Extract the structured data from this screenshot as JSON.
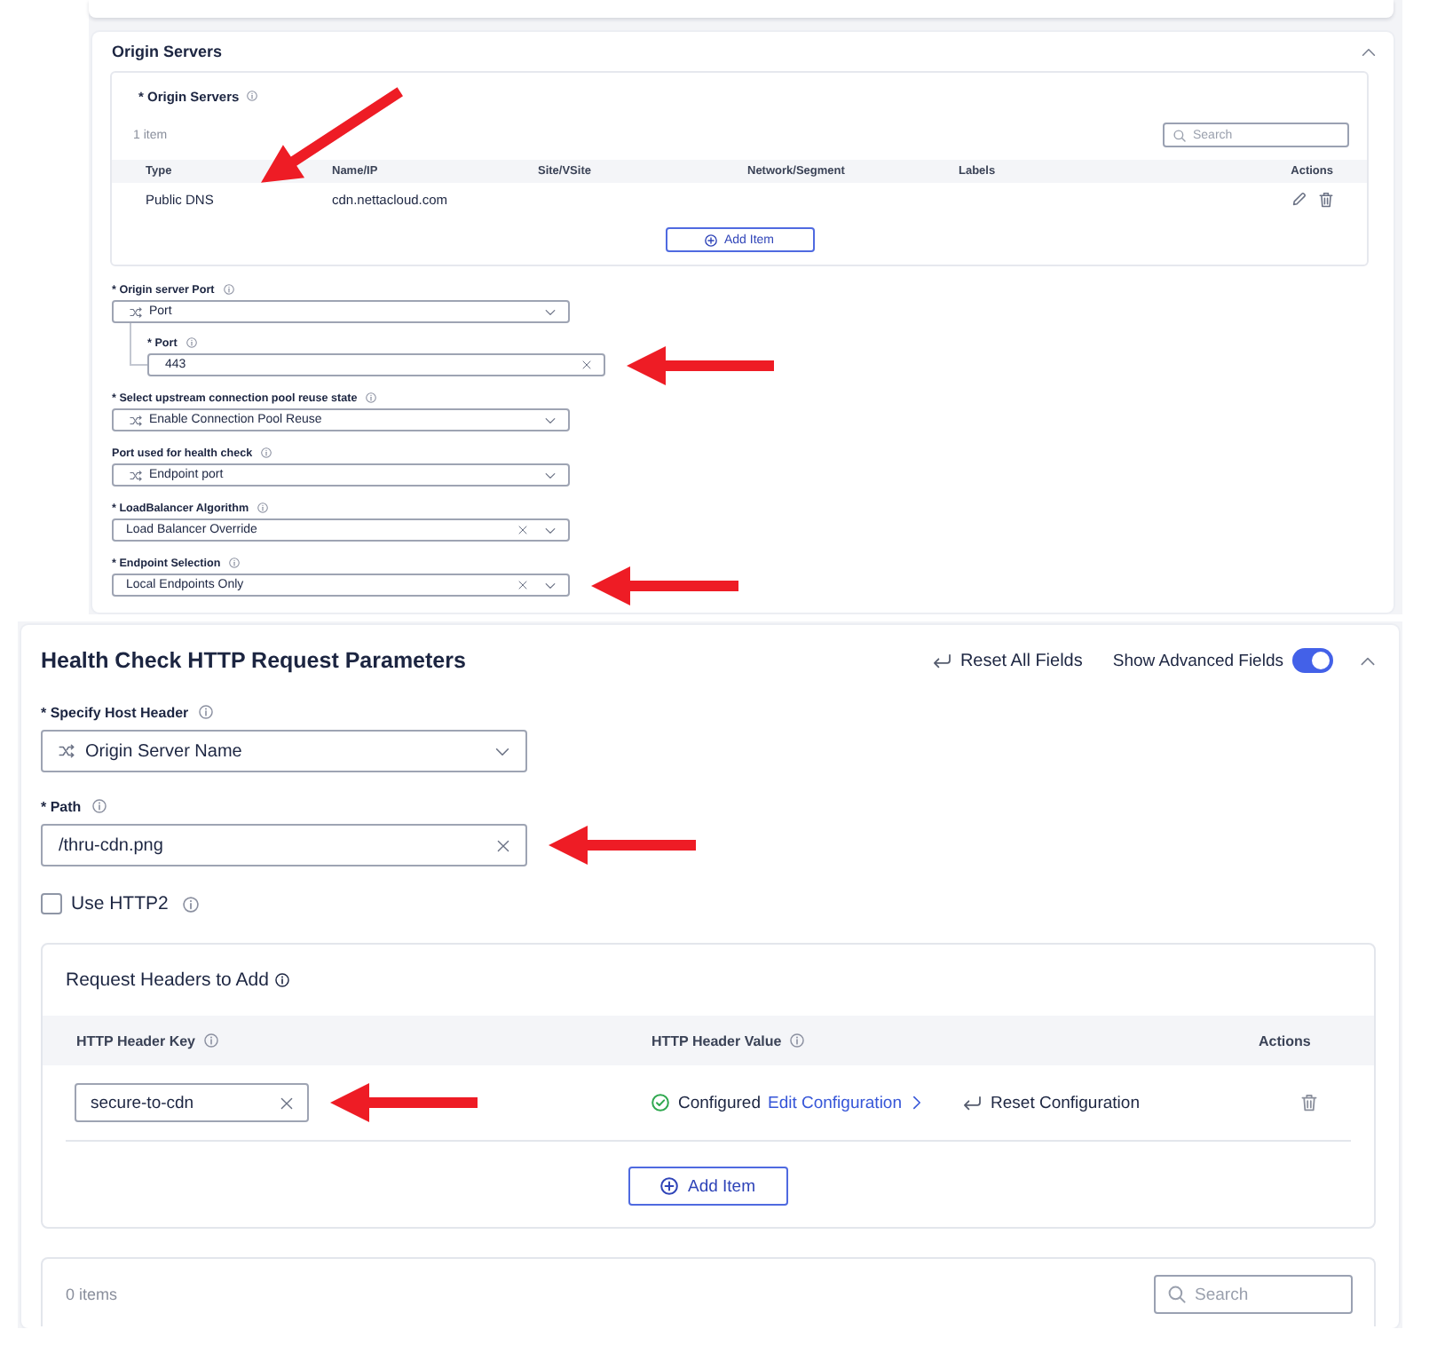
{
  "origin_servers": {
    "title": "Origin Servers",
    "expanded": true,
    "list": {
      "label": "* Origin Servers",
      "count": "1 item",
      "search": {
        "placeholder": "Search"
      },
      "columns": [
        "Type",
        "Name/IP",
        "Site/VSite",
        "Network/Segment",
        "Labels",
        "Actions"
      ],
      "rows": [
        {
          "type": "Public DNS",
          "name": "cdn.nettacloud.com",
          "arrow": true
        }
      ],
      "add_button": "Add Item"
    },
    "fields": [
      {
        "label": "* Origin server Port",
        "kind": "choice-select",
        "value": "Port",
        "arrow": false,
        "children": [
          {
            "label": "* Port",
            "kind": "text-input",
            "value": "443",
            "arrow": true
          }
        ]
      },
      {
        "label": "* Select upstream connection pool reuse state",
        "kind": "choice-select",
        "value": "Enable Connection Pool Reuse",
        "arrow": false
      },
      {
        "label": "Port used for health check",
        "kind": "choice-select",
        "value": "Endpoint port",
        "arrow": false
      },
      {
        "label": "* LoadBalancer Algorithm",
        "kind": "clearable-select",
        "value": "Load Balancer Override",
        "arrow": false
      },
      {
        "label": "* Endpoint Selection",
        "kind": "clearable-select",
        "value": "Local Endpoints Only",
        "arrow": true
      }
    ]
  },
  "health_check": {
    "title": "Health Check HTTP Request Parameters",
    "reset_all": "Reset All Fields",
    "advanced": {
      "label": "Show Advanced Fields",
      "on": true
    },
    "expanded": true,
    "fields": [
      {
        "label": "* Specify Host Header",
        "kind": "choice-select",
        "value": "Origin Server Name",
        "arrow": false
      },
      {
        "label": "* Path",
        "kind": "text-input",
        "value": "/thru-cdn.png",
        "arrow": true
      }
    ],
    "use_http2": {
      "label": "Use HTTP2",
      "checked": false
    },
    "request_headers": {
      "title": "Request Headers to Add",
      "columns": [
        {
          "label": "HTTP Header Key",
          "info": true
        },
        {
          "label": "HTTP Header Value",
          "info": true
        },
        {
          "label": "Actions",
          "info": false
        }
      ],
      "rows": [
        {
          "key": "secure-to-cdn",
          "status": "Configured",
          "edit_link": "Edit Configuration",
          "reset": "Reset Configuration",
          "arrow": true
        }
      ],
      "add_button": "Add Item"
    },
    "second_list": {
      "count": "0 items",
      "search": {
        "placeholder": "Search"
      }
    }
  }
}
